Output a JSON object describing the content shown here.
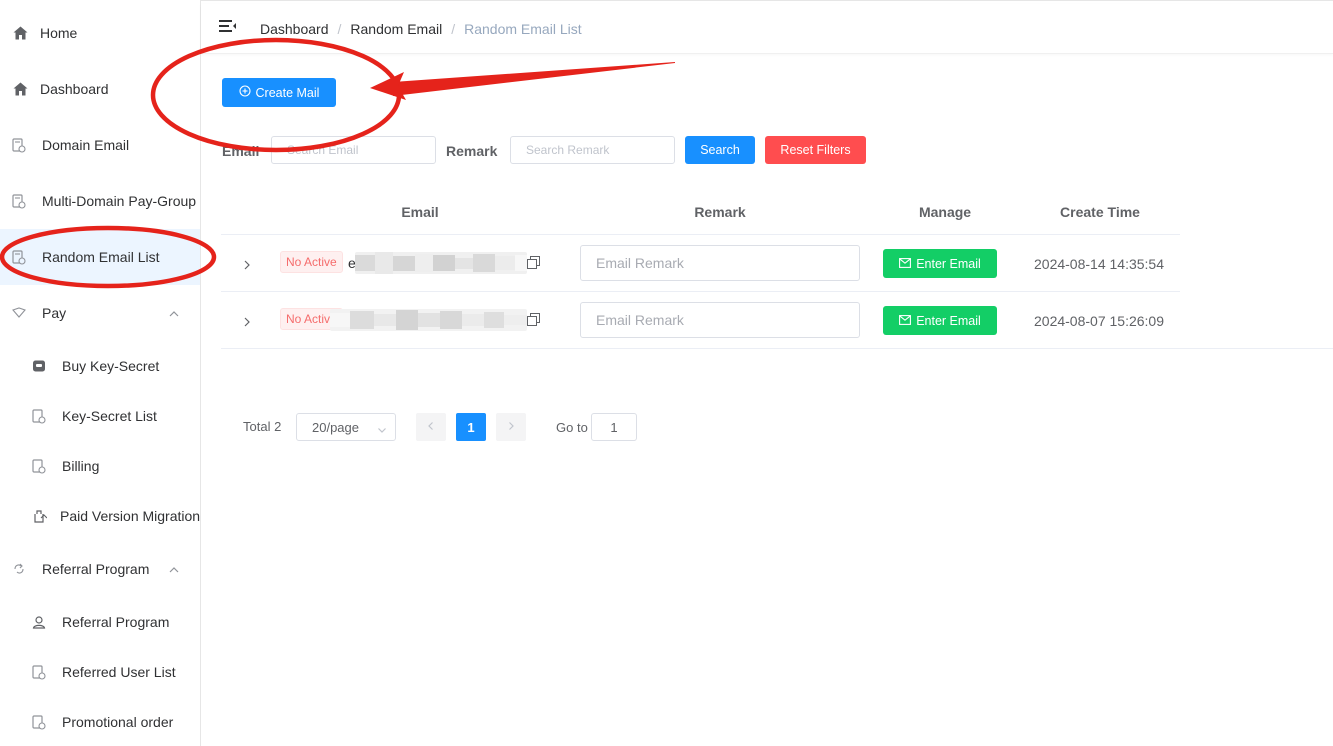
{
  "sidebar": {
    "items": [
      {
        "label": "Home",
        "icon": "home-icon"
      },
      {
        "label": "Dashboard",
        "icon": "home-icon"
      },
      {
        "label": "Domain Email",
        "icon": "document-icon"
      },
      {
        "label": "Multi-Domain Pay-Group",
        "icon": "document-icon"
      },
      {
        "label": "Random Email List",
        "icon": "document-icon",
        "active": true
      },
      {
        "label": "Pay",
        "icon": "pay-icon",
        "expanded": true
      },
      {
        "label": "Buy Key-Secret",
        "icon": "wallet-icon"
      },
      {
        "label": "Key-Secret List",
        "icon": "document-icon"
      },
      {
        "label": "Billing",
        "icon": "document-icon"
      },
      {
        "label": "Paid Version Migration",
        "icon": "migration-icon"
      },
      {
        "label": "Referral Program",
        "icon": "referral-icon",
        "expanded": true
      },
      {
        "label": "Referral Program",
        "icon": "user-icon"
      },
      {
        "label": "Referred User List",
        "icon": "document-icon"
      },
      {
        "label": "Promotional order",
        "icon": "document-icon"
      }
    ]
  },
  "breadcrumb": [
    "Dashboard",
    "Random Email",
    "Random Email List"
  ],
  "toolbar": {
    "create_label": "Create Mail"
  },
  "filters": {
    "email_label": "Email",
    "email_placeholder": "Search Email",
    "remark_label": "Remark",
    "remark_placeholder": "Search Remark",
    "search_label": "Search",
    "reset_label": "Reset Filters"
  },
  "table": {
    "columns": [
      "Email",
      "Remark",
      "Manage",
      "Create Time"
    ],
    "rows": [
      {
        "status": "No Active",
        "email_prefix": "e",
        "remark_placeholder": "Email Remark",
        "manage_label": "Enter Email",
        "create_time": "2024-08-14 14:35:54"
      },
      {
        "status": "No Active",
        "email_prefix": "",
        "remark_placeholder": "Email Remark",
        "manage_label": "Enter Email",
        "create_time": "2024-08-07 15:26:09"
      }
    ]
  },
  "pagination": {
    "total_label": "Total 2",
    "page_size": "20/page",
    "current_page": "1",
    "goto_label": "Go to",
    "goto_value": "1"
  },
  "colors": {
    "primary": "#1890ff",
    "danger": "#ff4d4f",
    "success": "#13ce66",
    "annotation": "#e5231b",
    "active_bg": "#ecf5ff"
  }
}
